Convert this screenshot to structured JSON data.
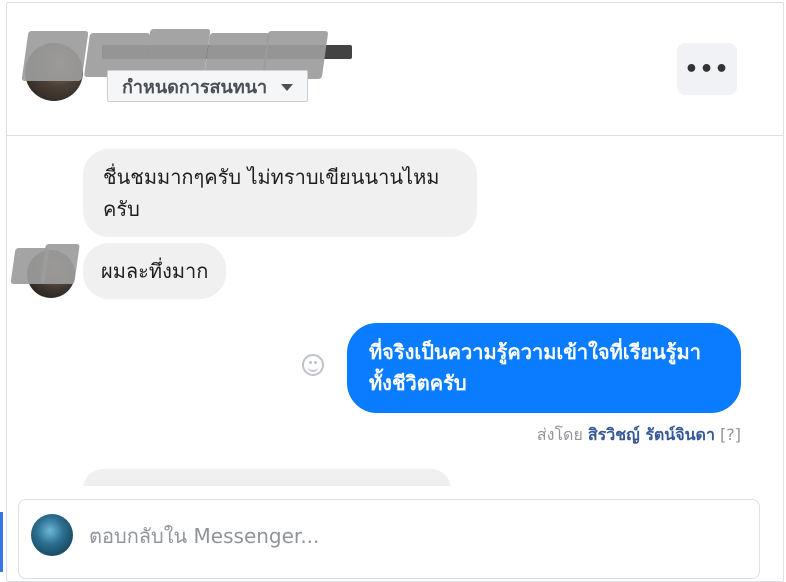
{
  "header": {
    "conversation_button_label": "กำหนดการสนทนา",
    "more_button_label": "•••"
  },
  "messages": [
    {
      "direction": "incoming",
      "text": "ชื่นชมมากๆครับ ไม่ทราบเขียนนานไหมครับ"
    },
    {
      "direction": "incoming",
      "text": "ผมละทึ่งมาก"
    },
    {
      "direction": "outgoing",
      "text": "ที่จริงเป็นความรู้ความเข้าใจที่เรียนรู้มาทั้งชีวิตครับ"
    }
  ],
  "sent_by": {
    "prefix": "ส่งโดย",
    "sender": "สิรวิชญ์ รัตน์จินดา",
    "help": "[?]"
  },
  "reply": {
    "placeholder": "ตอบกลับใน Messenger..."
  },
  "colors": {
    "outgoing_bubble": "#0a7cff",
    "incoming_bubble": "#f0f0f0",
    "link": "#365899"
  }
}
